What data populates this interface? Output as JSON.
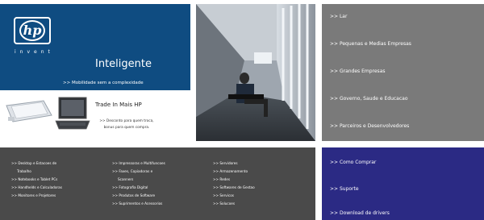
{
  "hp": {
    "logo_text": "hp",
    "invent": "invent",
    "title": "Inteligente",
    "tagline": ">> Mobilidade sem a complexidade"
  },
  "trade": {
    "title": "Trade In Mais HP",
    "desc_line1": ">> Desconto para quem troca,",
    "desc_line2": "bonus para quem compra."
  },
  "right_menu": [
    ">> Lar",
    ">> Pequenas e Medias Empresas",
    ">> Grandes Empresas",
    ">> Governo, Saude e Educacao",
    ">> Parceiros e Desenvolvedores"
  ],
  "categories": {
    "col1": [
      ">> Desktop e Estacoes de",
      "Trabalho",
      ">> Notebooks e Tablet PCs",
      ">> Handhelds e Calculadoras",
      ">> Monitores e Projetores"
    ],
    "col2": [
      ">> Impressoras e Multifuncoes",
      ">> Faxes, Copiadoras e",
      "Scanners",
      ">> Fotografia Digital",
      ">> Produtos de Software",
      ">> Suprimentos e Acessorios"
    ],
    "col3": [
      ">> Servidores",
      ">> Armazenamento",
      ">> Redes",
      ">> Softwares de Gestao",
      ">> Servicos",
      ">> Solucoes"
    ]
  },
  "navy_menu": [
    ">> Como Comprar",
    ">> Suporte",
    ">> Download de drivers"
  ],
  "colors": {
    "hp_blue": "#0f4c81",
    "menu_gray": "#7a7a7a",
    "dark_gray": "#4a4a4a",
    "navy": "#2b2a84"
  }
}
